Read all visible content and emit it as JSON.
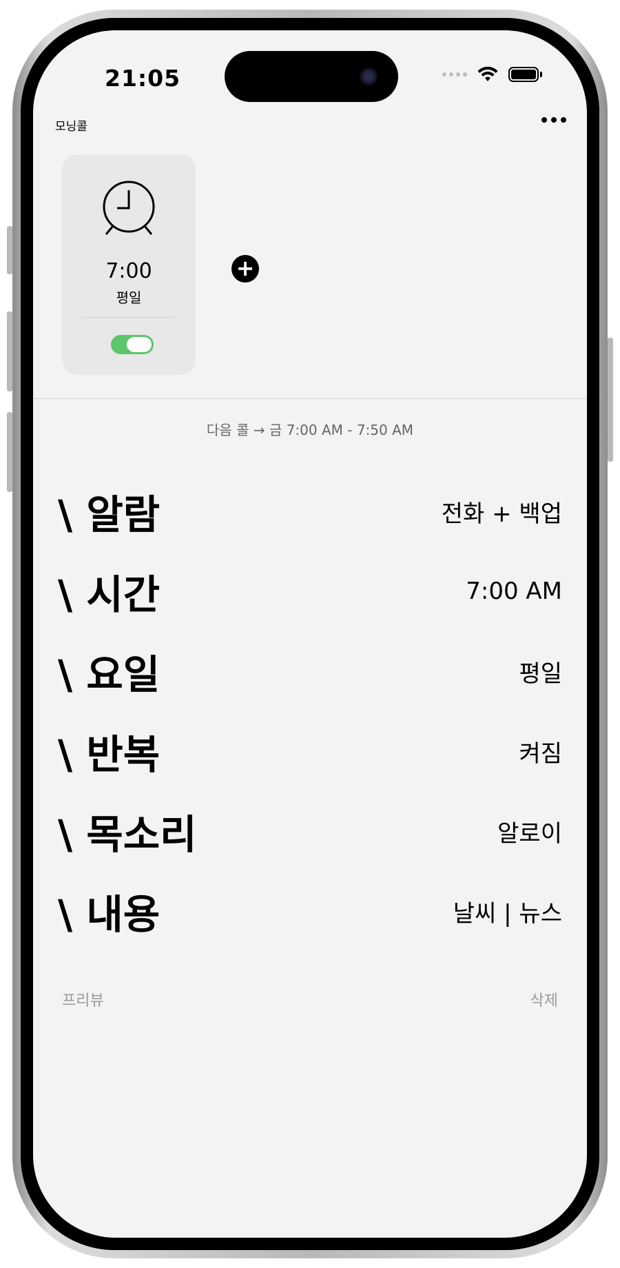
{
  "status_bar": {
    "time": "21:05"
  },
  "header": {
    "app_title": "모닝콜",
    "more_icon": "more-horizontal-icon"
  },
  "alarm_card": {
    "icon": "alarm-clock-icon",
    "time": "7:00",
    "days": "평일",
    "enabled": true,
    "toggle_color": "#5dc56a"
  },
  "add_alarm_icon": "plus-circle-icon",
  "next_call": "다음 콜 → 금 7:00 AM - 7:50 AM",
  "settings": [
    {
      "label": "\\ 알람",
      "value": "전화 + 백업"
    },
    {
      "label": "\\ 시간",
      "value": "7:00 AM"
    },
    {
      "label": "\\ 요일",
      "value": "평일"
    },
    {
      "label": "\\ 반복",
      "value": "켜짐"
    },
    {
      "label": "\\ 목소리",
      "value": "알로이"
    },
    {
      "label": "\\ 내용",
      "value": "날씨 | 뉴스"
    }
  ],
  "footer": {
    "preview_label": "프리뷰",
    "delete_label": "삭제"
  }
}
